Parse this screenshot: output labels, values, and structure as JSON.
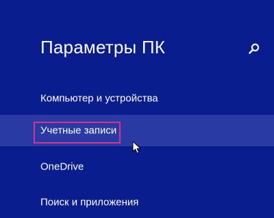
{
  "header": {
    "title": "Параметры ПК",
    "search_icon": "search-icon"
  },
  "menu": {
    "items": [
      {
        "label": "Компьютер и устройства",
        "selected": false
      },
      {
        "label": "Учетные записи",
        "selected": true
      },
      {
        "label": "OneDrive",
        "selected": false
      },
      {
        "label": "Поиск и приложения",
        "selected": false
      }
    ]
  },
  "colors": {
    "background": "#0a1d8f",
    "selected_row": "#2a3aa4",
    "focus_outline": "#e0308a",
    "text": "#ffffff"
  }
}
